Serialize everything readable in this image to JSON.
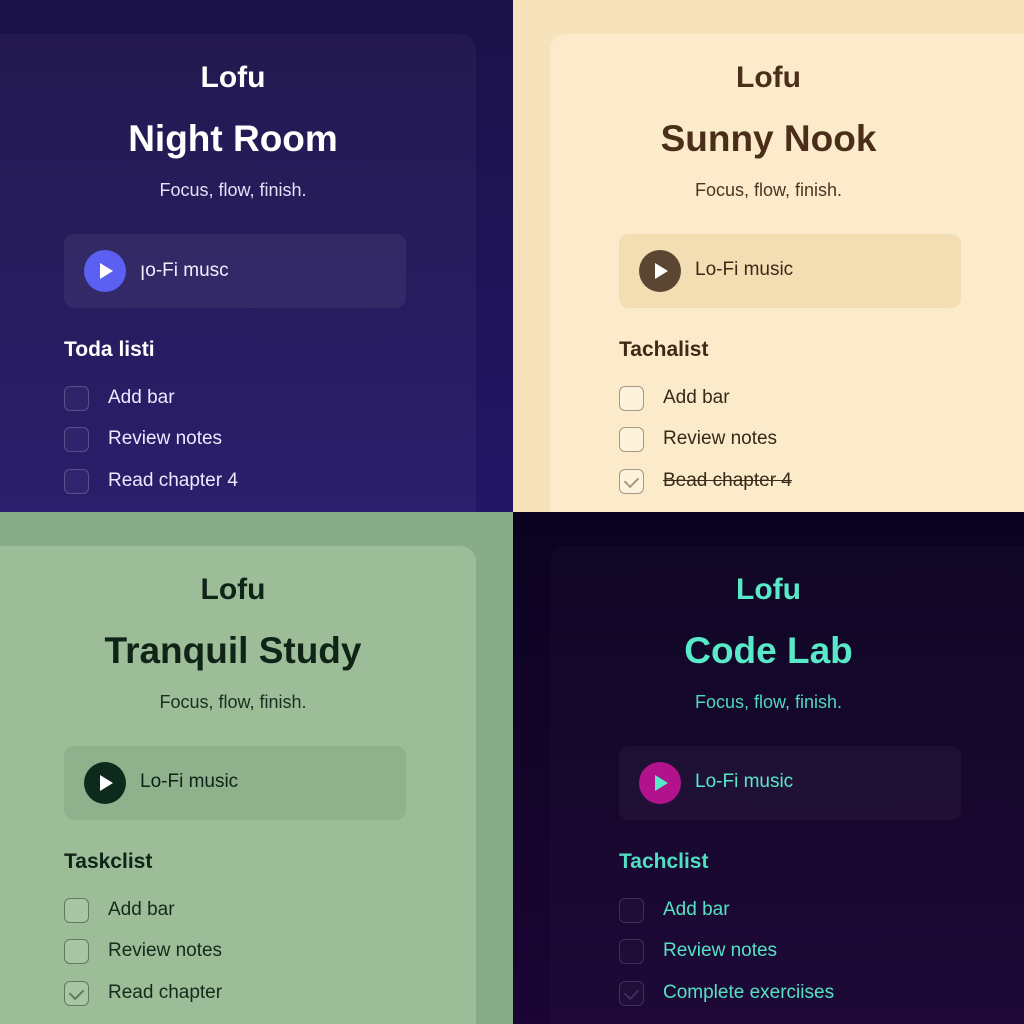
{
  "themes": [
    {
      "brand": "Lofu",
      "title": "Night Room",
      "tagline": "Focus, flow, finish.",
      "player_label": "ꞁo-Fi musc",
      "list_heading": "Toda listi",
      "tasks": [
        {
          "label": "Add bar",
          "checked": false
        },
        {
          "label": "Review notes",
          "checked": false
        },
        {
          "label": "Read chapter 4",
          "checked": false
        }
      ],
      "colors": {
        "background": "#1f1458",
        "accent": "#5b5ff2",
        "text": "#ffffff"
      }
    },
    {
      "brand": "Lofu",
      "title": "Sunny Nook",
      "tagline": "Focus, flow, finish.",
      "player_label": "Lo-Fi music",
      "list_heading": "Tachalist",
      "tasks": [
        {
          "label": "Add bar",
          "checked": false
        },
        {
          "label": "Review notes",
          "checked": false
        },
        {
          "label": "Bead chapter 4",
          "checked": true
        }
      ],
      "colors": {
        "background": "#fbebcb",
        "accent": "#5b4633",
        "text": "#4a2e1a"
      }
    },
    {
      "brand": "Lofu",
      "title": "Tranquil Study",
      "tagline": "Focus, flow, finish.",
      "player_label": "Lo-Fi music",
      "list_heading": "Taskclist",
      "tasks": [
        {
          "label": "Add bar",
          "checked": false
        },
        {
          "label": "Review notes",
          "checked": false
        },
        {
          "label": "Read chapter",
          "checked": true
        }
      ],
      "colors": {
        "background": "#9cbd98",
        "accent": "#0d2a1c",
        "text": "#0f2316"
      }
    },
    {
      "brand": "Lofu",
      "title": "Code Lab",
      "tagline": "Focus, flow, finish.",
      "player_label": "Lo-Fi music",
      "list_heading": "Tachclist",
      "tasks": [
        {
          "label": "Add bar",
          "checked": false
        },
        {
          "label": "Review notes",
          "checked": false
        },
        {
          "label": "Complete exerciises",
          "checked": true
        }
      ],
      "colors": {
        "background": "#10031f",
        "accent": "#b3128d",
        "text": "#58e9c9"
      }
    }
  ],
  "icons": {
    "play": "play-icon",
    "check": "checkmark-icon"
  }
}
